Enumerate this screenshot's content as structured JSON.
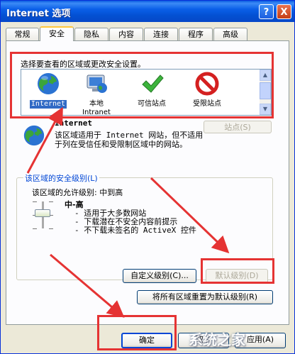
{
  "window": {
    "title": "Internet 选项",
    "help_label": "?",
    "close_label": "X"
  },
  "tabs": [
    {
      "label": "常规",
      "active": false
    },
    {
      "label": "安全",
      "active": true
    },
    {
      "label": "隐私",
      "active": false
    },
    {
      "label": "内容",
      "active": false
    },
    {
      "label": "连接",
      "active": false
    },
    {
      "label": "程序",
      "active": false
    },
    {
      "label": "高级",
      "active": false
    }
  ],
  "zones": {
    "prompt": "选择要查看的区域或更改安全设置。",
    "items": [
      {
        "label": "Internet",
        "icon": "globe-icon",
        "selected": true
      },
      {
        "label": "本地\nIntranet",
        "icon": "computer-globe-icon",
        "selected": false
      },
      {
        "label": "可信站点",
        "icon": "checkmark-icon",
        "selected": false
      },
      {
        "label": "受限站点",
        "icon": "no-entry-icon",
        "selected": false
      }
    ]
  },
  "zone_info": {
    "title": "Internet",
    "description": "该区域适用于 Internet 网站，但不适用于列在受信任和受限制区域中的网站。",
    "sites_button": "站点(S)"
  },
  "security_level": {
    "group_title": "该区域的安全级别(L)",
    "allowed_levels": "该区域的允许级别: 中到高",
    "level_name": "中-高",
    "bullets": [
      "- 适用于大多数网站",
      "- 下载潜在不安全内容前提示",
      "- 不下载未签名的 ActiveX 控件"
    ],
    "custom_button": "自定义级别(C)...",
    "default_button": "默认级别(D)",
    "reset_button": "将所有区域重置为默认级别(R)"
  },
  "footer": {
    "ok": "确定",
    "cancel": "取消",
    "apply": "应用(A)"
  },
  "watermark": "系统之家",
  "colors": {
    "annotation": "#E53333",
    "titlebar": "#0A5BE0",
    "selection": "#316AC5"
  }
}
